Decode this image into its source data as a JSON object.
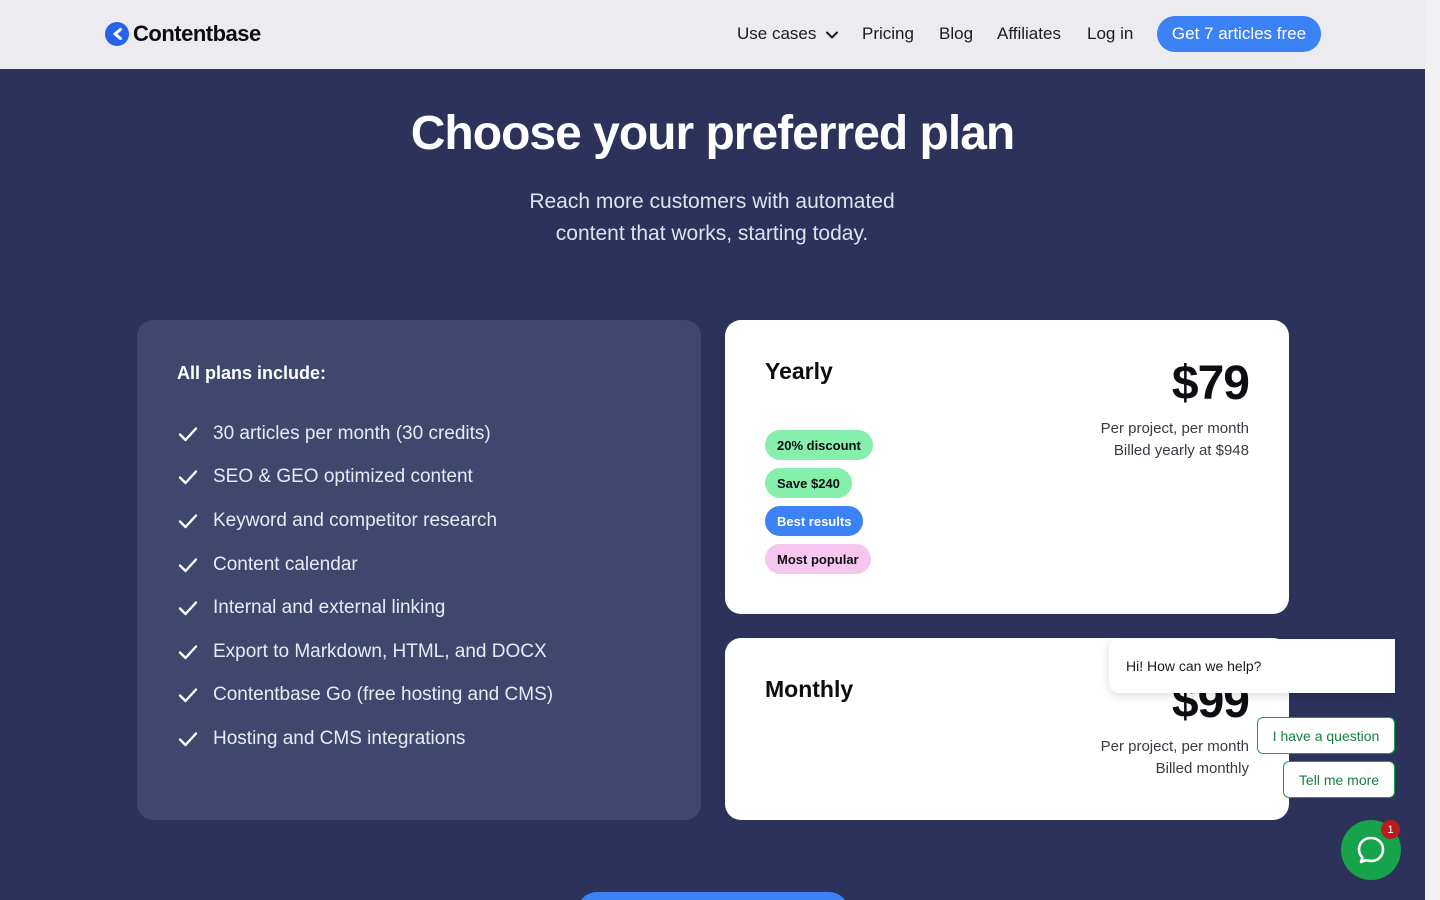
{
  "header": {
    "brand": "Contentbase",
    "nav": [
      {
        "label": "Use cases",
        "has_dropdown": true
      },
      {
        "label": "Pricing"
      },
      {
        "label": "Blog"
      },
      {
        "label": "Affiliates"
      },
      {
        "label": "Log in"
      }
    ],
    "cta_label": "Get 7 articles free"
  },
  "hero": {
    "title": "Choose your preferred plan",
    "subtitle_line1": "Reach more customers with automated",
    "subtitle_line2": "content that works, starting today."
  },
  "includes": {
    "title": "All plans include:",
    "features": [
      "30 articles per month (30 credits)",
      "SEO & GEO optimized content",
      "Keyword and competitor research",
      "Content calendar",
      "Internal and external linking",
      "Export to Markdown, HTML, and DOCX",
      "Contentbase Go (free hosting and CMS)",
      "Hosting and CMS integrations"
    ]
  },
  "plans": {
    "yearly": {
      "name": "Yearly",
      "price": "$79",
      "note_line1": "Per project, per month",
      "note_line2": "Billed yearly at $948",
      "badges": [
        {
          "label": "20% discount",
          "bg": "#86efac",
          "fg": "#0d0d12"
        },
        {
          "label": "Save $240",
          "bg": "#86efac",
          "fg": "#0d0d12"
        },
        {
          "label": "Best results",
          "bg": "#3b82f6",
          "fg": "#ffffff"
        },
        {
          "label": "Most popular",
          "bg": "#f5c6f0",
          "fg": "#0d0d12"
        }
      ]
    },
    "monthly": {
      "name": "Monthly",
      "price": "$99",
      "note_line1": "Per project, per month",
      "note_line2": "Billed monthly"
    }
  },
  "chat": {
    "greeting": "Hi! How can we help?",
    "options": [
      "I have a question",
      "Tell me more"
    ],
    "unread_count": "1"
  },
  "colors": {
    "background": "#2c325a",
    "accent": "#3b82f6",
    "chat_green": "#16a34a"
  }
}
